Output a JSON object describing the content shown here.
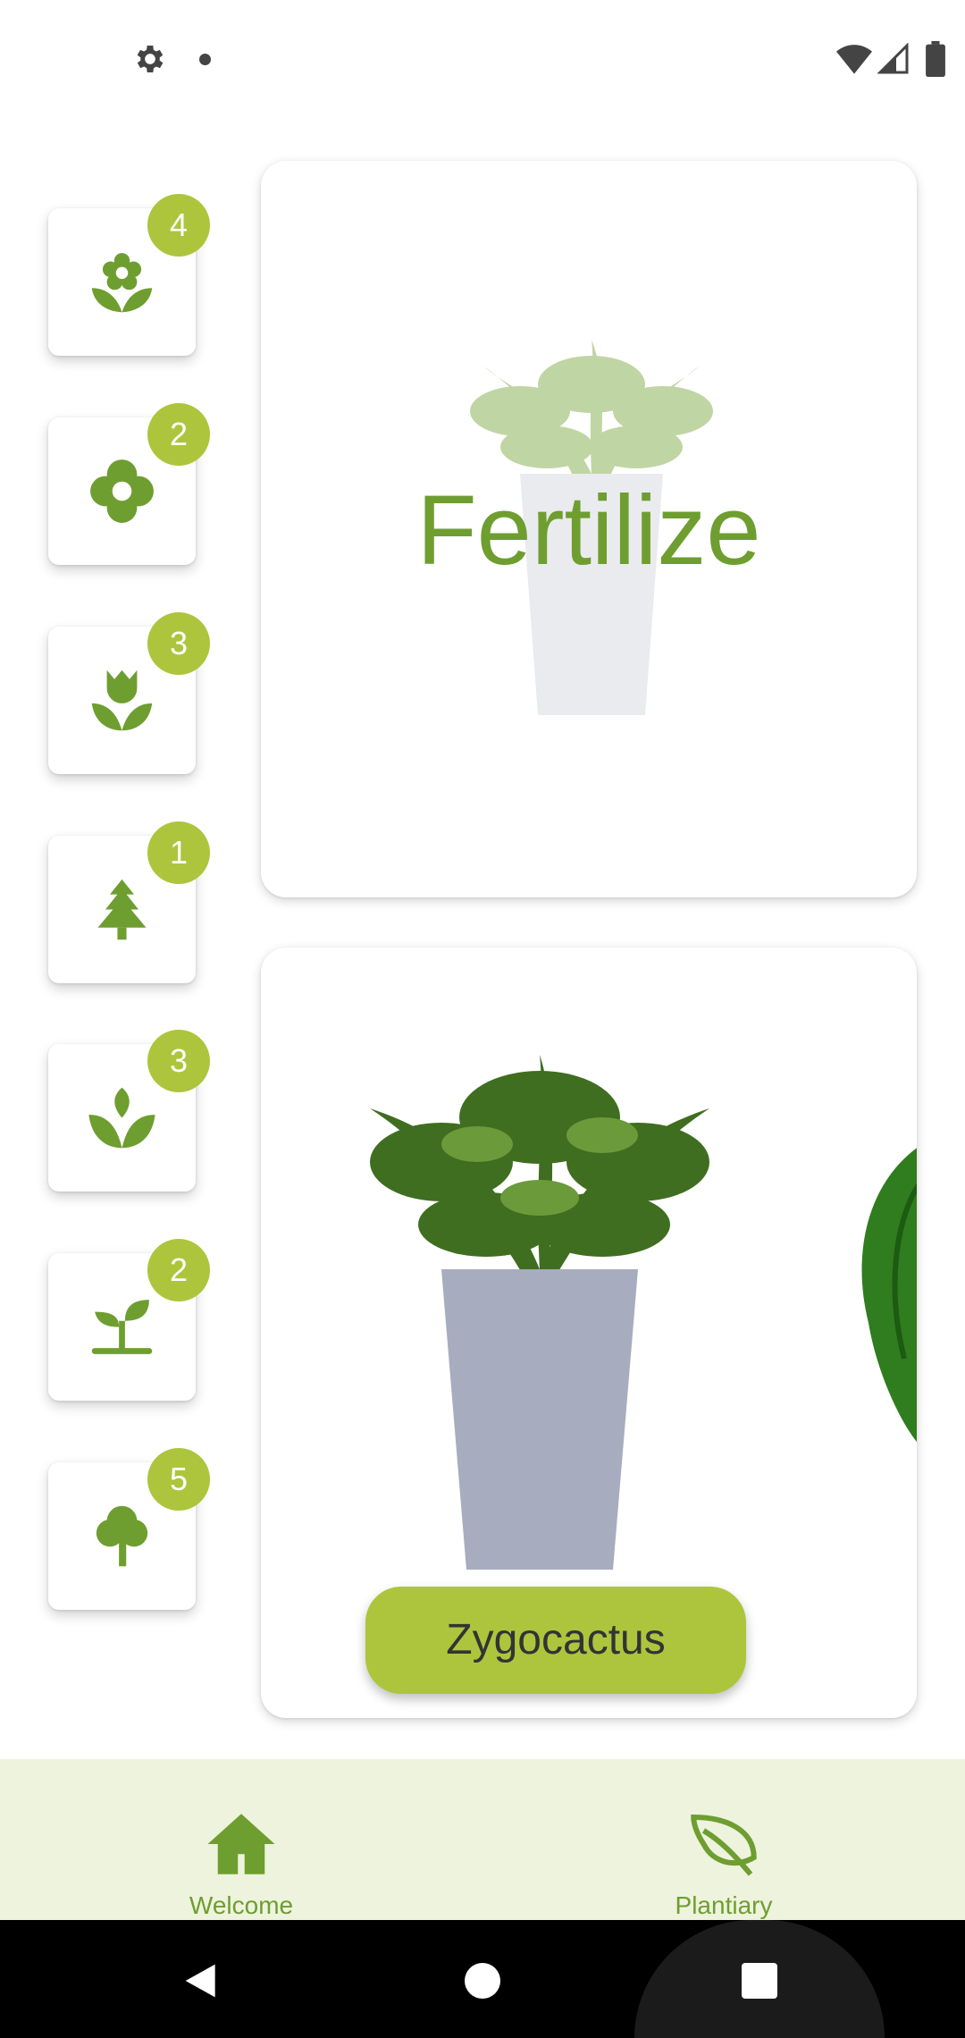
{
  "colors": {
    "accent": "#adc53c",
    "primary_green": "#6e9e30",
    "nav_background": "#eef3dd"
  },
  "status_bar": {
    "icons": [
      "gear-icon",
      "dot-icon",
      "wifi-icon",
      "signal-icon",
      "battery-icon"
    ]
  },
  "categories": [
    {
      "icon": "flower-icon",
      "count": "4"
    },
    {
      "icon": "four-petal-flower-icon",
      "count": "2"
    },
    {
      "icon": "tulip-icon",
      "count": "3"
    },
    {
      "icon": "pine-tree-icon",
      "count": "1"
    },
    {
      "icon": "sprout-leaves-icon",
      "count": "3"
    },
    {
      "icon": "seedling-icon",
      "count": "2"
    },
    {
      "icon": "tree-icon",
      "count": "5"
    }
  ],
  "cards": {
    "fertilize_label": "Fertilize",
    "plant_name": "Zygocactus"
  },
  "bottom_nav": {
    "items": [
      {
        "label": "Welcome",
        "icon": "home-icon"
      },
      {
        "label": "Plantiary",
        "icon": "leaf-icon"
      }
    ]
  },
  "system_nav": {
    "icons": [
      "back-icon",
      "home-circle-icon",
      "recents-icon"
    ]
  }
}
